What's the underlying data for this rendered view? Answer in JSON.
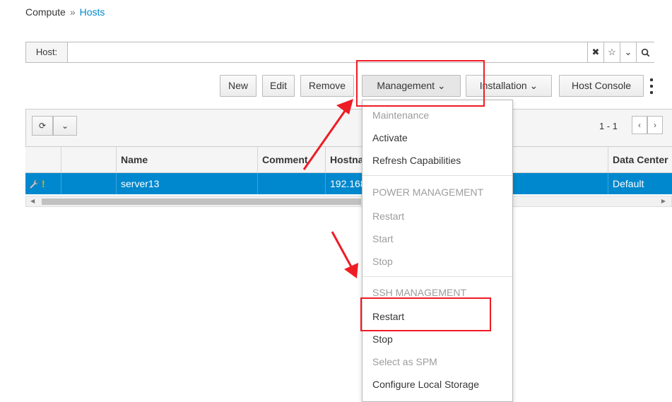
{
  "breadcrumb": {
    "parent": "Compute",
    "separator": "»",
    "current": "Hosts"
  },
  "search": {
    "label": "Host:",
    "value": "",
    "placeholder": "",
    "clear_glyph": "✖",
    "bookmark_glyph": "☆",
    "dropdown_glyph": "⌄",
    "search_glyph": "🔍"
  },
  "toolbar": {
    "new_label": "New",
    "edit_label": "Edit",
    "remove_label": "Remove",
    "management_label": "Management ⌄",
    "installation_label": "Installation ⌄",
    "host_console_label": "Host Console"
  },
  "grid": {
    "refresh_glyph": "⟳",
    "refresh_dropdown_glyph": "⌄",
    "pagination": "1 - 1",
    "prev_glyph": "‹",
    "next_glyph": "›",
    "columns": [
      "Name",
      "Comment",
      "Hostname/IP",
      "Data Center"
    ],
    "row": {
      "name": "server13",
      "comment": "",
      "hostname": "192.168.1.13",
      "data_center": "Default",
      "status_glyph": "!"
    }
  },
  "management_menu": {
    "maintenance": "Maintenance",
    "activate": "Activate",
    "refresh_capabilities": "Refresh Capabilities",
    "power_header": "POWER MANAGEMENT",
    "power_restart": "Restart",
    "power_start": "Start",
    "power_stop": "Stop",
    "ssh_header": "SSH MANAGEMENT",
    "ssh_restart": "Restart",
    "ssh_stop": "Stop",
    "select_spm": "Select as SPM",
    "configure_local_storage": "Configure Local Storage"
  },
  "colors": {
    "accent": "#0088ce",
    "annotation": "#ee1c25",
    "disabled_text": "#9c9c9c"
  },
  "icons": {
    "wrench": "wrench-icon",
    "warning": "exclamation-icon",
    "refresh": "refresh-icon",
    "kebab": "kebab-icon"
  }
}
